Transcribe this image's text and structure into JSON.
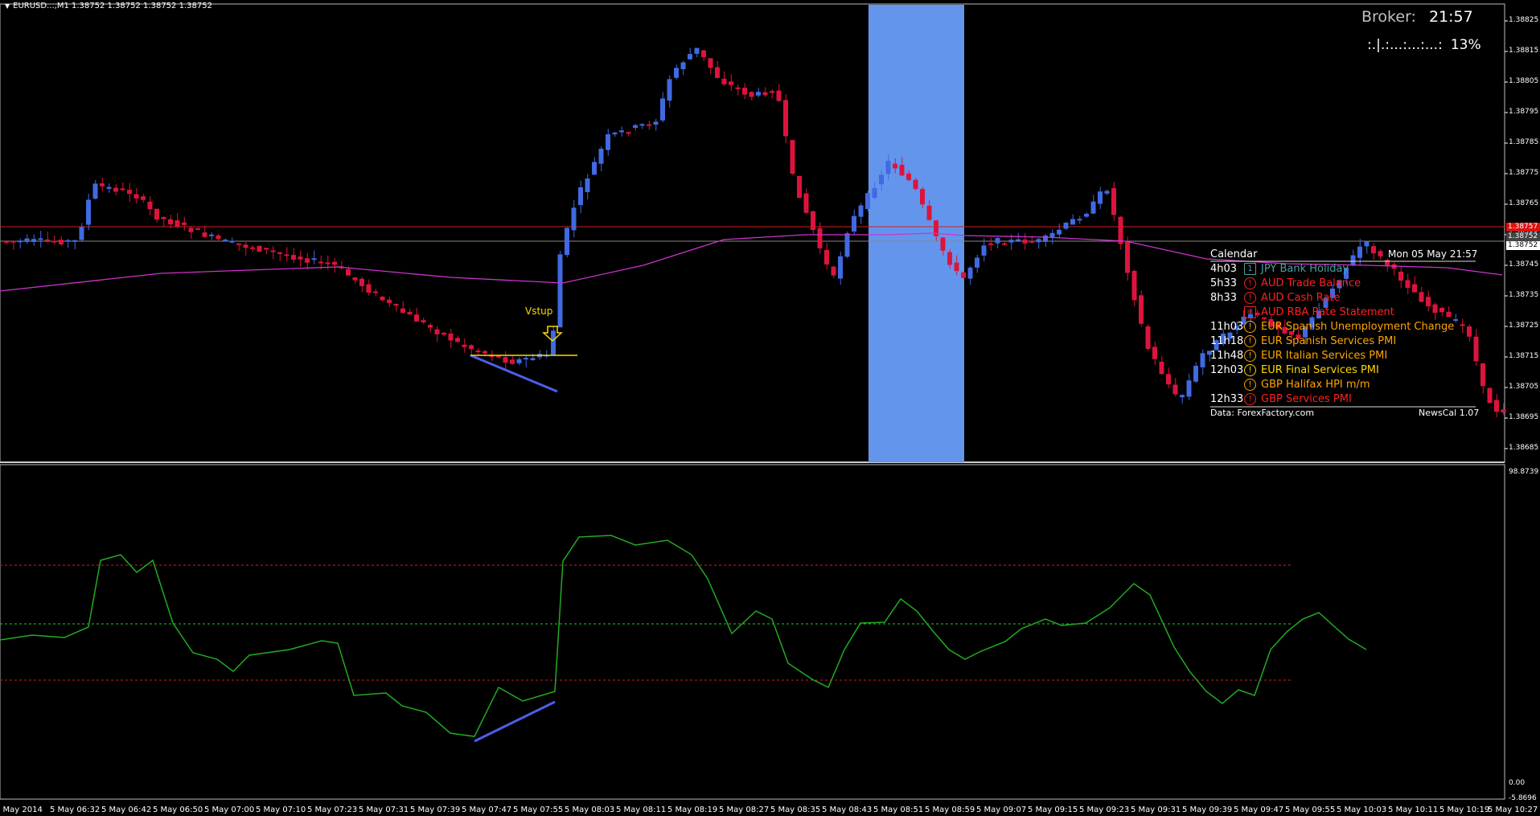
{
  "header": {
    "symbol_line": "EURUSD...,M1  1.38752 1.38752 1.38752 1.38752",
    "arrow_icon": "triangle-down-icon"
  },
  "broker": {
    "label": "Broker:",
    "time": "21:57"
  },
  "progress": {
    "bar": ":.|.:...:...:...:",
    "percent": "13%"
  },
  "price_axis": {
    "labels": [
      "1.38825",
      "1.38815",
      "1.38805",
      "1.38795",
      "1.38785",
      "1.38775",
      "1.38765",
      "1.38755",
      "1.38745",
      "1.38735",
      "1.38725",
      "1.38715",
      "1.38705",
      "1.38695",
      "1.38685"
    ],
    "red_tag": "1.38757",
    "bid_tag": "1.38752",
    "white_tag": "1.38752"
  },
  "oscillator_axis": {
    "top": "98.8739",
    "zero": "0.00",
    "bottom": "-5.8696"
  },
  "time_axis": [
    "5 May 2014",
    "5 May 06:32",
    "5 May 06:42",
    "5 May 06:50",
    "5 May 07:00",
    "5 May 07:10",
    "5 May 07:23",
    "5 May 07:31",
    "5 May 07:39",
    "5 May 07:47",
    "5 May 07:55",
    "5 May 08:03",
    "5 May 08:11",
    "5 May 08:19",
    "5 May 08:27",
    "5 May 08:35",
    "5 May 08:43",
    "5 May 08:51",
    "5 May 08:59",
    "5 May 09:07",
    "5 May 09:15",
    "5 May 09:23",
    "5 May 09:31",
    "5 May 09:39",
    "5 May 09:47",
    "5 May 09:55",
    "5 May 10:03",
    "5 May 10:11",
    "5 May 10:19",
    "5 May 10:27"
  ],
  "annotation": {
    "label": "Vstup"
  },
  "calendar": {
    "title": "Calendar",
    "date": "Mon 05 May 21:57",
    "events": [
      {
        "time": "4h03",
        "icon": "1",
        "icon_name": "holiday-icon",
        "text": "JPY  Bank Holiday",
        "color": "#48a0a0"
      },
      {
        "time": "5h33",
        "icon": "!",
        "icon_name": "high-impact-icon",
        "text": "AUD Trade Balance",
        "color": "#ff2020"
      },
      {
        "time": "8h33",
        "icon": "!",
        "icon_name": "high-impact-icon",
        "text": "AUD Cash Rate",
        "color": "#ff2020"
      },
      {
        "time": "",
        "icon": "≡",
        "icon_name": "statement-icon",
        "text": "AUD RBA Rate Statement",
        "color": "#ff2020"
      },
      {
        "time": "11h03",
        "icon": "!",
        "icon_name": "medium-impact-icon",
        "text": "EUR Spanish Unemployment Change",
        "color": "#ffa500"
      },
      {
        "time": "11h18",
        "icon": "!",
        "icon_name": "medium-impact-icon",
        "text": "EUR Spanish Services PMI",
        "color": "#ffa500"
      },
      {
        "time": "11h48",
        "icon": "!",
        "icon_name": "medium-impact-icon",
        "text": "EUR Italian Services PMI",
        "color": "#ffa500"
      },
      {
        "time": "12h03",
        "icon": "!",
        "icon_name": "medium-impact-icon",
        "text": "EUR Final Services PMI",
        "color": "#ffd700"
      },
      {
        "time": "",
        "icon": "!",
        "icon_name": "medium-impact-icon",
        "text": "GBP Halifax HPI m/m",
        "color": "#ffa500"
      },
      {
        "time": "12h33",
        "icon": "!",
        "icon_name": "high-impact-icon",
        "text": "GBP Services PMI",
        "color": "#ff2020"
      }
    ],
    "footer_source": "Data: ForexFactory.com",
    "footer_version": "NewsCal 1.07"
  },
  "colors": {
    "bull": "#4169e1",
    "bear": "#dc143c",
    "ma": "#cc33cc",
    "highlight": "#6495ed",
    "oscillator": "#22aa22"
  }
}
